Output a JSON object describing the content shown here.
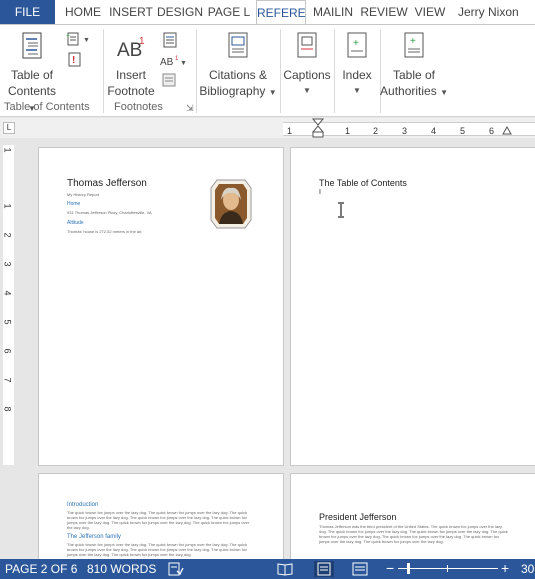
{
  "tabs": {
    "file": "FILE",
    "home": "HOME",
    "insert": "INSERT",
    "design": "DESIGN",
    "page_layout": "PAGE L",
    "references": "REFERE",
    "mailings": "MAILIN",
    "review": "REVIEW",
    "view": "VIEW"
  },
  "user_name": "Jerry Nixon",
  "ribbon": {
    "toc_group_label": "Table of Contents",
    "toc_button_line1": "Table of",
    "toc_button_line2": "Contents",
    "footnotes_group_label": "Footnotes",
    "insert_footnote_line1": "Insert",
    "insert_footnote_line2": "Footnote",
    "citations_line1": "Citations &",
    "citations_line2": "Bibliography",
    "captions": "Captions",
    "index": "Index",
    "authorities_line1": "Table of",
    "authorities_line2": "Authorities"
  },
  "ruler": {
    "ticks": [
      "1",
      "1",
      "1",
      "2",
      "3",
      "4",
      "5",
      "6"
    ],
    "vticks": [
      "1",
      "1",
      "2",
      "3",
      "4",
      "5",
      "6",
      "7",
      "8"
    ]
  },
  "pages": {
    "p1": {
      "name": "Thomas Jefferson",
      "subtitle": "My History Report",
      "home_label": "Home",
      "address": "931 Thomas Jefferson Pkwy, Charlottesville, VA",
      "altitude_label": "Altitude",
      "altitude_text": "Thomas' house is 272.52 meters in the air."
    },
    "p2": {
      "title": "The Table of Contents",
      "cursor": "I"
    },
    "p3": {
      "intro_heading": "Introduction",
      "intro_text": "The quick brown fox jumps over the lazy dog. The quick brown fox jumps over the lazy dog. The quick brown fox jumps over the lazy dog. The quick brown fox jumps over the lazy dog. The quick brown fox jumps over the lazy dog. The quick brown fox jumps over the lazy dog. The quick brown fox jumps over the lazy dog.",
      "family_heading": "The Jefferson family",
      "family_text": "The quick brown fox jumps over the lazy dog. The quick brown fox jumps over the lazy dog. The quick brown fox jumps over the lazy dog. The quick brown fox jumps over the lazy dog. The quick brown fox jumps over the lazy dog. The quick brown fox jumps over the lazy dog."
    },
    "p4": {
      "title": "President Jefferson",
      "text": "Thomas Jefferson was the third president of the United States. The quick brown fox jumps over the lazy dog. The quick brown fox jumps over the lazy dog. The quick brown fox jumps over the lazy dog. The quick brown fox jumps over the lazy dog. The quick brown fox jumps over the lazy dog. The quick brown fox jumps over the lazy dog. The quick brown fox jumps over the lazy dog."
    }
  },
  "status": {
    "page": "PAGE 2 OF 6",
    "words": "810 WORDS",
    "zoom_minus": "−",
    "zoom_plus": "+",
    "zoom_value": "30"
  },
  "colors": {
    "accent": "#2b579a",
    "heading": "#2e74b5"
  }
}
